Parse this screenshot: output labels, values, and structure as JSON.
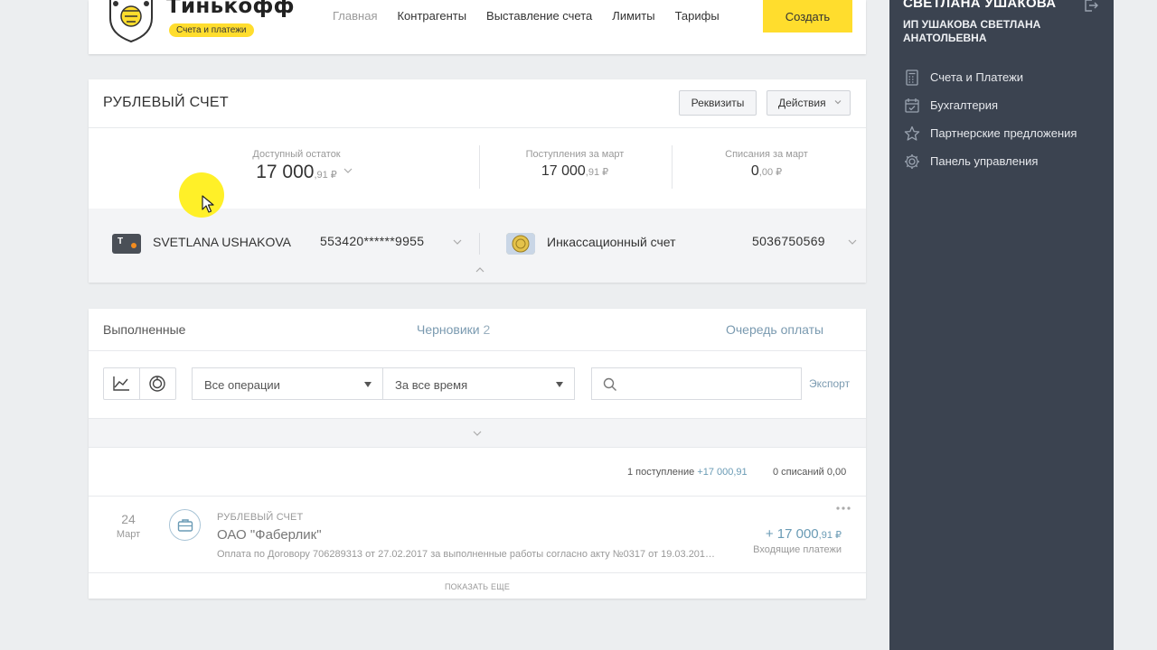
{
  "header": {
    "logo_text": "Тинькофф",
    "logo_badge": "Счета и платежи",
    "nav": [
      "Главная",
      "Контрагенты",
      "Выставление счета",
      "Лимиты",
      "Тарифы"
    ],
    "create_label": "Создать"
  },
  "sidebar": {
    "user_name": "СВЕТЛАНА УШАКОВА",
    "company": "ИП УШАКОВА СВЕТЛАНА АНАТОЛЬЕВНА",
    "items": [
      {
        "label": "Счета и Платежи",
        "icon": "calculator-icon"
      },
      {
        "label": "Бухгалтерия",
        "icon": "calendar-check-icon"
      },
      {
        "label": "Партнерские предложения",
        "icon": "star-icon"
      },
      {
        "label": "Панель управления",
        "icon": "gear-icon"
      }
    ]
  },
  "account": {
    "title": "РУБЛЕВЫЙ СЧЕТ",
    "requisites_label": "Реквизиты",
    "actions_label": "Действия",
    "balance_label": "Доступный остаток",
    "balance_main": "17 000",
    "balance_cents": ",91 ₽",
    "income_label": "Поступления за март",
    "income_main": "17 000",
    "income_cents": ",91 ₽",
    "outgo_label": "Списания за март",
    "outgo_main": "0",
    "outgo_cents": ",00 ₽",
    "card_holder": "SVETLANA USHAKOVA",
    "card_number": "553420******9955",
    "collection_label": "Инкассационный счет",
    "collection_number": "5036750569"
  },
  "operations": {
    "tabs": {
      "done": "Выполненные",
      "drafts": "Черновики",
      "drafts_count": "2",
      "queue": "Очередь оплаты"
    },
    "filter_ops": "Все операции",
    "filter_period": "За все время",
    "search_placeholder": "",
    "export_label": "Экспорт",
    "summary_in": "1 поступление",
    "summary_in_amount": "+17 000,91",
    "summary_out": "0 списаний 0,00",
    "row": {
      "day": "24",
      "month": "Март",
      "type": "РУБЛЕВЫЙ СЧЕТ",
      "name": "ОАО \"Фаберлик\"",
      "description": "Оплата по Договору 706289313 от 27.02.2017 за выполненные работы согласно акту №0317 от 19.03.201…",
      "amount_main": "+ 17 000",
      "amount_cents": ",91 ₽",
      "category": "Входящие платежи"
    },
    "show_more": "ПОКАЗАТЬ ЕЩЕ"
  },
  "colors": {
    "brand_yellow": "#ffdd2d",
    "sidebar_bg": "#3b4350",
    "link_blue": "#7a9ab0"
  }
}
